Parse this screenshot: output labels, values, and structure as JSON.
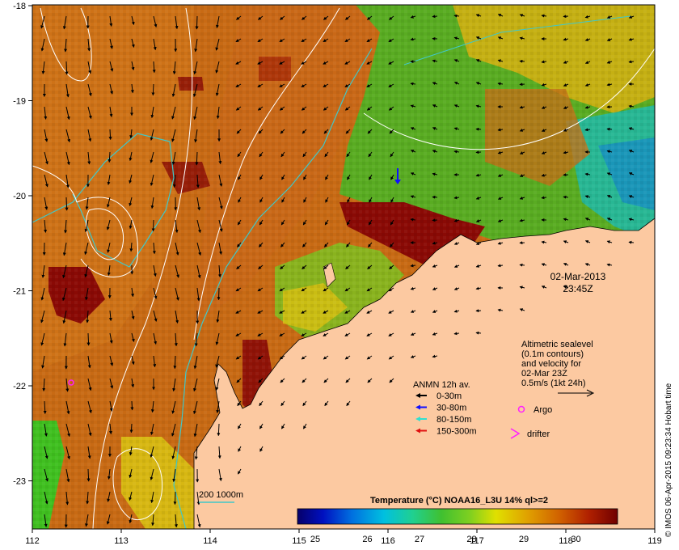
{
  "axes": {
    "lon_ticks": [
      "112",
      "113",
      "114",
      "115",
      "116",
      "117",
      "118",
      "119"
    ],
    "lat_ticks": [
      "-18",
      "-19",
      "-20",
      "-21",
      "-22",
      "-23"
    ]
  },
  "timestamp": {
    "date": "02-Mar-2013",
    "time": "23:45Z"
  },
  "altimetry": {
    "line1": "Altimetric sealevel",
    "line2": "(0.1m contours)",
    "line3": "and velocity for",
    "line4": "02-Mar 23Z",
    "line5": "0.5m/s (1kt 24h)"
  },
  "anmn": {
    "title": "ANMN 12h av.",
    "items": [
      {
        "label": "0-30m",
        "color": "#000000"
      },
      {
        "label": "30-80m",
        "color": "#1010ff"
      },
      {
        "label": "80-150m",
        "color": "#30e0d0"
      },
      {
        "label": "150-300m",
        "color": "#e01010"
      }
    ]
  },
  "markers": {
    "argo": "Argo",
    "drifter": "drifter"
  },
  "bathymetry_legend": "200  1000m",
  "colorbar": {
    "title": "Temperature (°C) NOAA16_L3U 14% ql>=2",
    "labels": [
      "25",
      "26",
      "27",
      "28",
      "29",
      "30"
    ]
  },
  "credit": "© IMOS 06-Apr-2015 09:23:34 Hobart time",
  "colors": {
    "land": "#fcc9a1",
    "warm_sst": "#c06010",
    "hot_sst": "#8a0a05",
    "mid_sst": "#4cba1e",
    "cool_sst": "#20b0a0",
    "isobath": "#40c8c8",
    "contour": "#ffffff"
  }
}
